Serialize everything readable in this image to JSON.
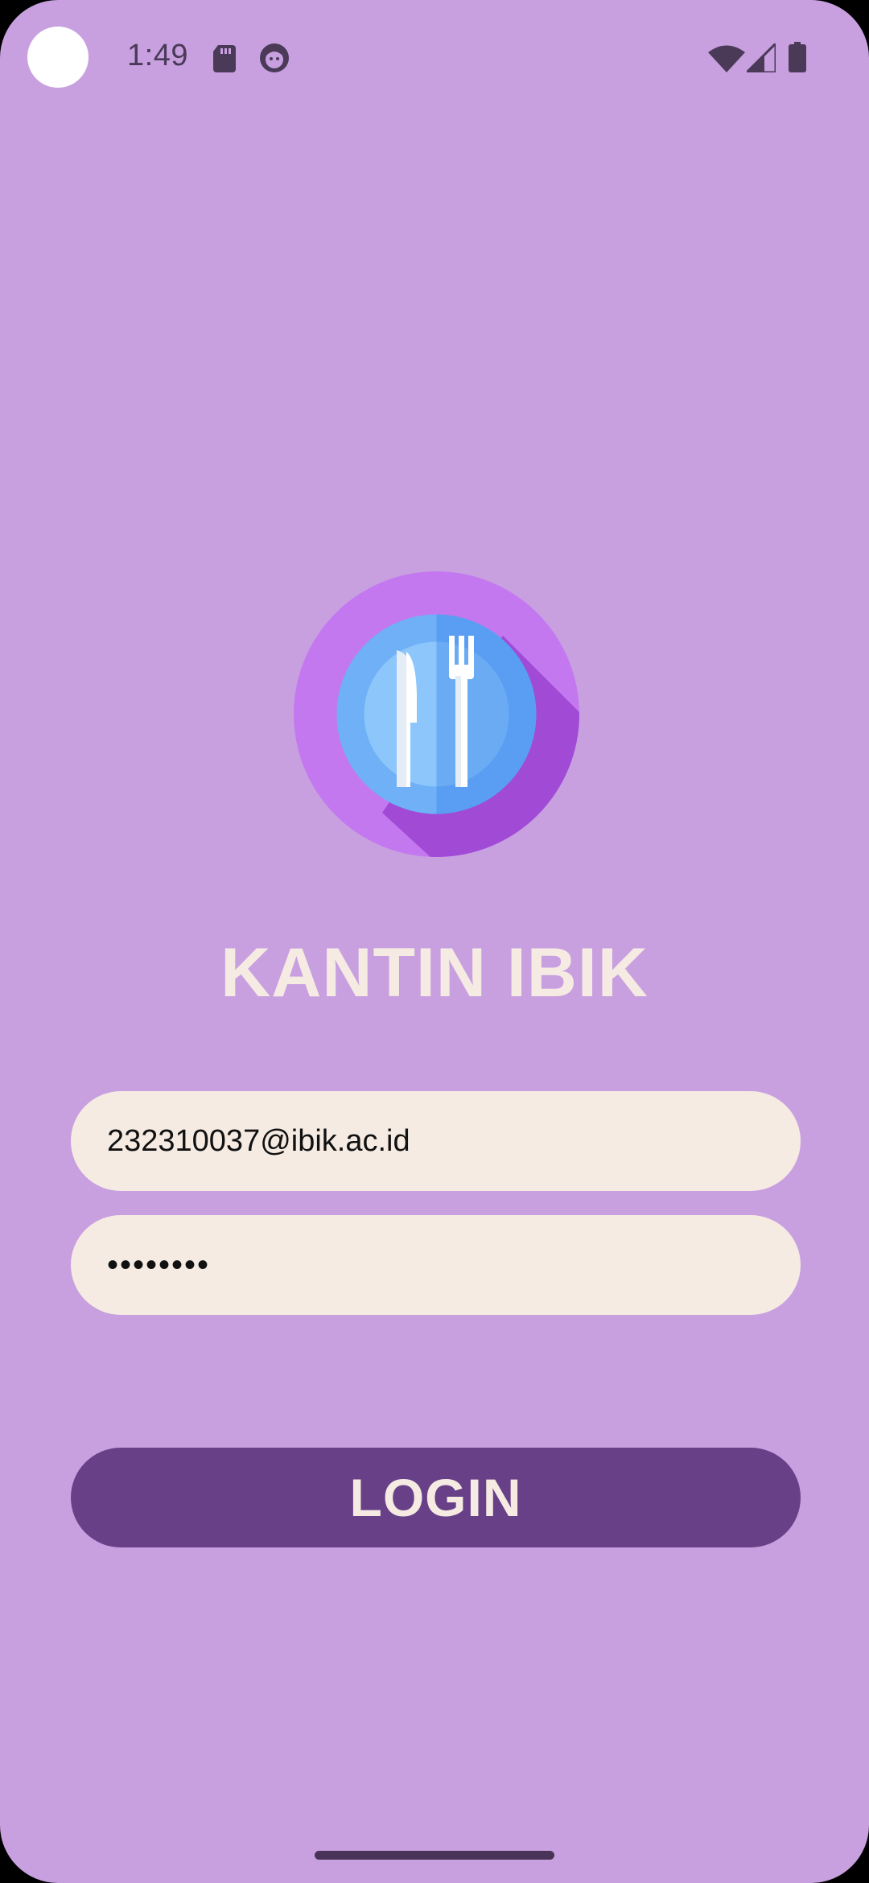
{
  "status_bar": {
    "time": "1:49",
    "icons": [
      "sd-card-icon",
      "face-icon",
      "wifi-icon",
      "signal-icon",
      "battery-icon"
    ]
  },
  "logo": {
    "icon": "plate-knife-fork-icon"
  },
  "app": {
    "title": "KANTIN IBIK"
  },
  "form": {
    "email_value": "232310037@ibik.ac.id",
    "password_value": "••••••••",
    "login_label": "LOGIN"
  },
  "colors": {
    "background": "#c8a0e0",
    "field_background": "#f5ebe3",
    "button_background": "#674087",
    "title_color": "#f5ebe3"
  }
}
